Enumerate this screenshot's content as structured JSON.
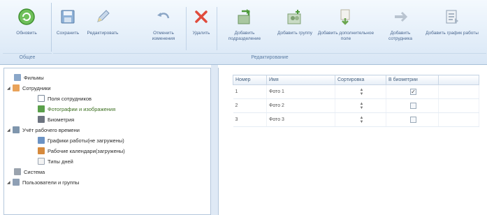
{
  "ribbon": {
    "groups": {
      "general": "Общее",
      "edit": "Редактирование"
    },
    "buttons": [
      {
        "label": "Обновить"
      },
      {
        "label": "Сохранить"
      },
      {
        "label": "Редактировать"
      },
      {
        "label": "Отменить изменения"
      },
      {
        "label": "Удалить"
      },
      {
        "label": "Добавить подразделение"
      },
      {
        "label": "Добавить группу"
      },
      {
        "label": "Добавить дополнительное поле"
      },
      {
        "label": "Добавить сотрудника"
      },
      {
        "label": "Добавить график работы"
      }
    ]
  },
  "tree": {
    "items": [
      {
        "label": "Фильмы"
      },
      {
        "label": "Сотрудники"
      },
      {
        "label": "Поля сотрудников"
      },
      {
        "label": "Фотографии и изображения"
      },
      {
        "label": "Биометрия"
      },
      {
        "label": "Учёт рабочего времени"
      },
      {
        "label": "Графики работы(не загружены)"
      },
      {
        "label": "Рабочие календари(загружены)"
      },
      {
        "label": "Типы дней"
      },
      {
        "label": "Система"
      },
      {
        "label": "Пользователи и группы"
      }
    ]
  },
  "grid": {
    "columns": [
      "Номер",
      "Имя",
      "Сортировка",
      "В биометрии"
    ],
    "rows": [
      {
        "num": "1",
        "name": "Фото 1",
        "checked": true
      },
      {
        "num": "2",
        "name": "Фото 2",
        "checked": false
      },
      {
        "num": "3",
        "name": "Фото 3",
        "checked": false
      }
    ]
  },
  "colors": {
    "ribbon_bg": "#e3eef9",
    "accent": "#4a6790",
    "selected_text": "#3b6e1f"
  }
}
